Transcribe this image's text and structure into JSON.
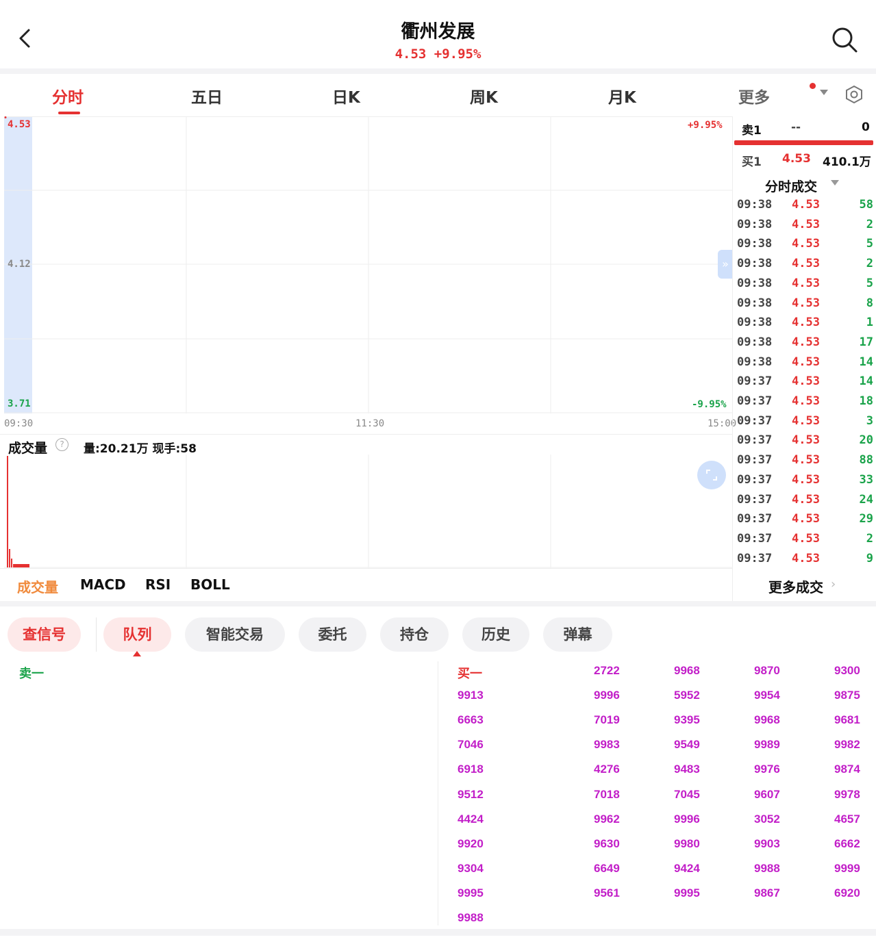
{
  "header": {
    "title": "衢州发展",
    "subtitle": "4.53 +9.95%"
  },
  "tabs": [
    "分时",
    "五日",
    "日K",
    "周K",
    "月K",
    "更多"
  ],
  "chart": {
    "price_top": "4.53",
    "price_mid": "4.12",
    "price_bottom": "3.71",
    "pct_up": "+9.95%",
    "pct_down": "-9.95%",
    "time_start": "09:30",
    "time_mid": "11:30",
    "time_end": "15:00"
  },
  "volume": {
    "label": "成交量",
    "info": "量:20.21万 现手:58"
  },
  "chart_data": {
    "type": "line",
    "title": "",
    "xlabel": "",
    "ylabel": "",
    "ylim": [
      3.71,
      4.53
    ],
    "grid": true,
    "x": [
      "09:30",
      "11:30",
      "15:00"
    ],
    "series": [
      {
        "values": [
          4.53
        ]
      }
    ]
  },
  "orderbook": {
    "sell1_label": "卖1",
    "sell1_price": "--",
    "sell1_vol": "0",
    "buy1_label": "买1",
    "buy1_price": "4.53",
    "buy1_vol": "410.1万",
    "ticks_title": "分时成交"
  },
  "ticks": [
    {
      "time": "09:38",
      "price": "4.53",
      "vol": "58"
    },
    {
      "time": "09:38",
      "price": "4.53",
      "vol": "2"
    },
    {
      "time": "09:38",
      "price": "4.53",
      "vol": "5"
    },
    {
      "time": "09:38",
      "price": "4.53",
      "vol": "2"
    },
    {
      "time": "09:38",
      "price": "4.53",
      "vol": "5"
    },
    {
      "time": "09:38",
      "price": "4.53",
      "vol": "8"
    },
    {
      "time": "09:38",
      "price": "4.53",
      "vol": "1"
    },
    {
      "time": "09:38",
      "price": "4.53",
      "vol": "17"
    },
    {
      "time": "09:38",
      "price": "4.53",
      "vol": "14"
    },
    {
      "time": "09:37",
      "price": "4.53",
      "vol": "14"
    },
    {
      "time": "09:37",
      "price": "4.53",
      "vol": "18"
    },
    {
      "time": "09:37",
      "price": "4.53",
      "vol": "3"
    },
    {
      "time": "09:37",
      "price": "4.53",
      "vol": "20"
    },
    {
      "time": "09:37",
      "price": "4.53",
      "vol": "88"
    },
    {
      "time": "09:37",
      "price": "4.53",
      "vol": "33"
    },
    {
      "time": "09:37",
      "price": "4.53",
      "vol": "24"
    },
    {
      "time": "09:37",
      "price": "4.53",
      "vol": "29"
    },
    {
      "time": "09:37",
      "price": "4.53",
      "vol": "2"
    },
    {
      "time": "09:37",
      "price": "4.53",
      "vol": "9"
    }
  ],
  "indicators": [
    "成交量",
    "MACD",
    "RSI",
    "BOLL"
  ],
  "more_trades": "更多成交",
  "pills": [
    "查信号",
    "队列",
    "智能交易",
    "委托",
    "持仓",
    "历史",
    "弹幕"
  ],
  "queue": {
    "sell_label": "卖一",
    "buy_label": "买一",
    "buy_rows": [
      [
        "2722",
        "9968",
        "9870",
        "9300"
      ],
      [
        "9913",
        "9996",
        "5952",
        "9954",
        "9875"
      ],
      [
        "6663",
        "7019",
        "9395",
        "9968",
        "9681"
      ],
      [
        "7046",
        "9983",
        "9549",
        "9989",
        "9982"
      ],
      [
        "6918",
        "4276",
        "9483",
        "9976",
        "9874"
      ],
      [
        "9512",
        "7018",
        "7045",
        "9607",
        "9978"
      ],
      [
        "4424",
        "9962",
        "9996",
        "3052",
        "4657"
      ],
      [
        "9920",
        "9630",
        "9980",
        "9903",
        "6662"
      ],
      [
        "9304",
        "6649",
        "9424",
        "9988",
        "9999"
      ],
      [
        "9995",
        "9561",
        "9995",
        "9867",
        "6920"
      ],
      [
        "9988"
      ]
    ]
  },
  "colors": {
    "up": "#e53131",
    "down": "#1aa34a",
    "queue": "#c21ec8",
    "indicator_active": "#f08a3c"
  }
}
